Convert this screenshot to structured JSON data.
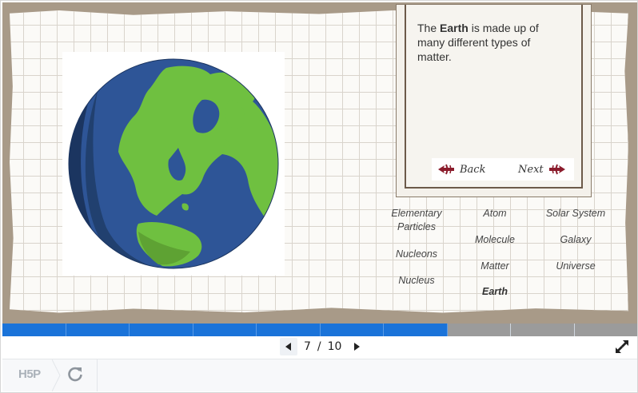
{
  "slide": {
    "description_prefix": "The ",
    "description_bold": "Earth",
    "description_suffix": " is made up of many different types of matter.",
    "back_label": "Back",
    "next_label": "Next",
    "words": {
      "col1": [
        "Elementary Particles",
        "Nucleons",
        "Nucleus"
      ],
      "col2": [
        "Atom",
        "Molecule",
        "Matter",
        "Earth"
      ],
      "col3": [
        "Solar System",
        "Galaxy",
        "Universe"
      ]
    },
    "current_word": "Earth"
  },
  "progress": {
    "total_segments": 10,
    "completed_segments": 7
  },
  "pager": {
    "current": "7",
    "separator": "/",
    "total": "10"
  },
  "footer": {
    "logo_text": "H5P"
  },
  "icons": {
    "prev": "triangle-left-icon",
    "next": "triangle-right-icon",
    "fullscreen": "expand-arrows-icon",
    "reload": "reload-icon",
    "back_ornament": "fleur-left-icon",
    "next_ornament": "fleur-right-icon"
  },
  "colors": {
    "progress_done": "#1a73d9",
    "progress_remaining": "#9b9b9b",
    "ornament": "#8b1c2c",
    "earth_ocean": "#2e5597",
    "earth_land": "#6fc040",
    "earth_shadow": "#1b3560"
  }
}
